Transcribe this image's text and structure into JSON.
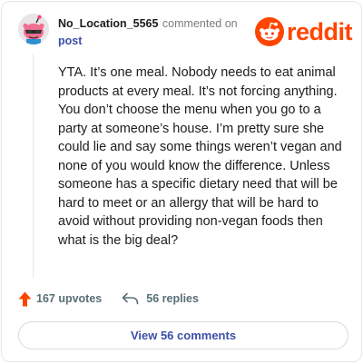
{
  "comment": {
    "username": "No_Location_5565",
    "action_text": "commented on",
    "post_link_label": "post",
    "avatar_icon": "snoo-avatar-icon",
    "body": "YTA. It’s one meal. Nobody needs to eat animal products at every meal. It’s not forcing anything. You don’t choose the menu when you go to a party at someone’s house. I’m pretty sure she could lie and say some things weren’t vegan and none of you would know the difference. Unless someone has a specific dietary need that will be hard to meet or an allergy that will be hard to avoid without providing non-vegan foods then what is the big deal?"
  },
  "brand": {
    "wordmark": "reddit",
    "logo_icon": "reddit-snoo-icon",
    "color": "#ff4500"
  },
  "footer": {
    "upvote_icon": "upvote-arrow-icon",
    "upvotes_label": "167 upvotes",
    "reply_icon": "reply-arrow-icon",
    "replies_label": "56 replies"
  },
  "view_button_label": "View 56 comments",
  "colors": {
    "accent": "#ff4500",
    "link": "#3d4fa8",
    "text": "#1c1c1c",
    "muted": "#576f76"
  }
}
